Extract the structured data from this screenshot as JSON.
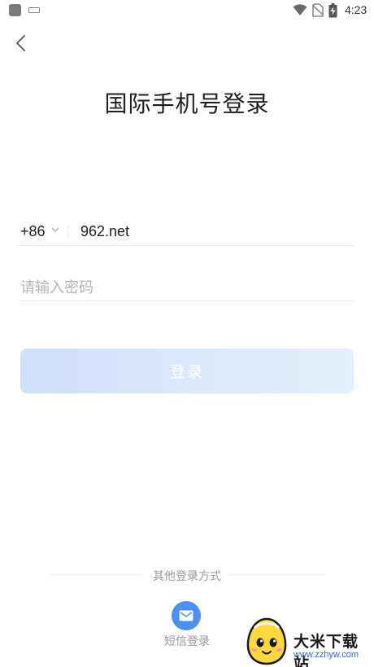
{
  "status_bar": {
    "time": "4:23",
    "icons": [
      "app-square-icon",
      "keyboard-icon",
      "wifi-icon",
      "no-sim-icon",
      "battery-charging-icon"
    ]
  },
  "header": {
    "back_icon": "chevron-left-icon",
    "title": "国际手机号登录"
  },
  "form": {
    "country_code": "+86",
    "country_code_icon": "chevron-down-icon",
    "phone_value": "962.net",
    "password_placeholder": "请输入密码"
  },
  "login_button": {
    "label": "登录",
    "colors": {
      "start": "#cfe0fc",
      "end": "#e6effd"
    }
  },
  "other_login": {
    "title": "其他登录方式",
    "sms_label": "短信登录",
    "sms_icon": "message-icon",
    "accent": "#4c8ff5"
  },
  "watermark": {
    "title": "大米下载站",
    "url": "www.zzhyw.com"
  }
}
